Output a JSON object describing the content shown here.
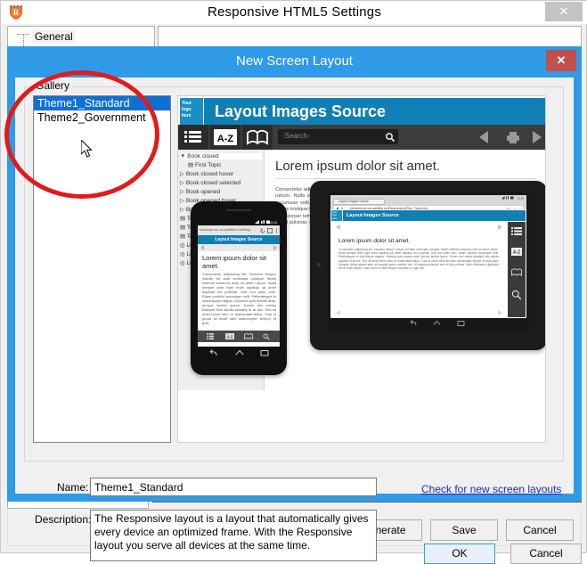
{
  "parent_window": {
    "title": "Responsive HTML5 Settings",
    "app_icon": "shield-r-icon",
    "close_label": "✕",
    "tab_general": "General",
    "buttons": {
      "save_and_generate": "Save and Generate",
      "save": "Save",
      "cancel": "Cancel"
    }
  },
  "dialog": {
    "title": "New Screen Layout",
    "close_label": "✕",
    "gallery": {
      "legend": "Gallery",
      "items": [
        {
          "label": "Theme1_Standard",
          "selected": true
        },
        {
          "label": "Theme2_Government",
          "selected": false
        }
      ]
    },
    "form": {
      "name_label": "Name:",
      "name_value": "Theme1_Standard",
      "description_label": "Description:",
      "description_value": "The Responsive layout is a layout that automatically gives every device an optimized frame. With the Responsive layout you serve all devices at the same time."
    },
    "link_check_layouts": "Check for new screen layouts",
    "ok_label": "OK",
    "cancel_label": "Cancel"
  },
  "preview": {
    "desktop": {
      "logo_text": "Your logo here",
      "header_title": "Layout Images Source",
      "search_placeholder": "-Search-",
      "tab_icons": [
        "list-icon",
        "a-z-icon",
        "book-icon"
      ],
      "nav_icons": [
        "prev-arrow-icon",
        "print-icon",
        "next-arrow-icon"
      ],
      "heading": "Lorem ipsum dolor sit amet.",
      "body": "Consectetur adipiscing elit. Vivamus tempor mauris vel ante venenatis volutpat. Morbi eleifend euismod nulla sit amet rutrum. Nulla semper ante eget enim dapibus sit amet dapibus dui pulvinar. Sed non justo odio. Etiam porttitor accumsan velit. Pellentesque in scelerisque magna. Vivamus quis mauris ante, tempor lacinia ipsum. Donec nec metus tristique felis iaculis sodales id at nisi. Sed sit amet lorem sem, in malesuada tellus. Cras id purus sit amet odio ullamcorper tempor et quis justo. Quisque luctus aliquet ante, at suscipit metus porttitor non. Ut egestas posuere sem id nisi pulvinar. Nunc bibendum dignissim mi sit amet lobortis. Nam at nisi et felis semper molestie eu eget nisi.",
      "tree_items": [
        "Book closed",
        "First Topic",
        "Book closed hover",
        "Book closed selected",
        "Book opened",
        "Book opened hover",
        "Book opened selected",
        "Topic",
        "Topic hover",
        "Topic selected",
        "Link",
        "Link hover",
        "Link selected"
      ]
    },
    "phone": {
      "url": "robohelp.en-us.webfilm.eu/Resp",
      "header_title": "Layout Images Source",
      "heading": "Lorem ipsum dolor sit amet.",
      "body": "Consectetur adipiscing elit. Vivamus tempor mauris vel ante venenatis volutpat. Morbi eleifend euismod nulla sit amet rutrum. Nulla semper ante eget enim dapibus sit amet dapibus dui pulvinar. Sed non justo odio. Etiam porttitor accumsan velit. Pellentesque in scelerisque magna. Vivamus quis mauris ante, tempor lacinia ipsum. Donec nec metus tristique felis iaculis sodales id at nisi. Sed sit amet lorem sem, in malesuada tellus. Cras id purus sit amet odio ullamcorper tempor et quis.",
      "toolbar_icons": [
        "list-icon",
        "a-z-icon",
        "book-icon",
        "search-icon"
      ],
      "softkeys": [
        "back-icon",
        "home-icon",
        "recents-icon"
      ]
    },
    "tablet": {
      "tab_title": "Layout Images Source",
      "url": "robohelp.en-us.webfilm.eu/Responsive/First_Topic.htm",
      "logo_text": "Your logo here",
      "header_title": "Layout Images Source",
      "heading": "Lorem ipsum dolor sit amet.",
      "side_icons": [
        "list-icon",
        "a-z-icon",
        "book-icon",
        "search-icon"
      ],
      "softkeys": [
        "back-icon",
        "home-icon",
        "recents-icon"
      ]
    }
  },
  "annotation": {
    "shape": "ellipse",
    "color": "#e01b1b"
  },
  "colors": {
    "dialog_accent": "#2f9ae8",
    "selection": "#0e6fd6",
    "close_red": "#c0504d",
    "link": "#1a27c8",
    "site_header": "#0f7fb5"
  }
}
